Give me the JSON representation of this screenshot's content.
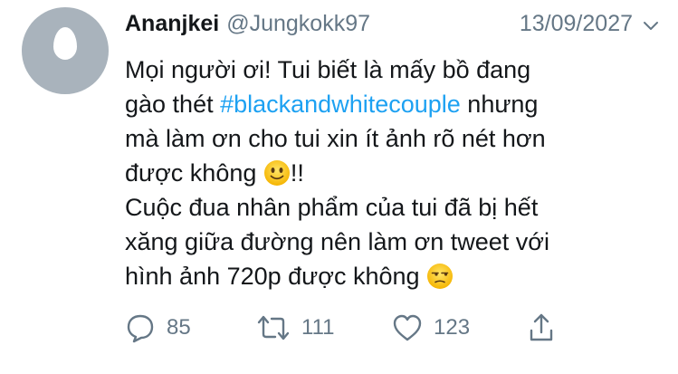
{
  "tweet": {
    "author_name": "Ananjkei",
    "handle": "@Jungkokk97",
    "date": "13/09/2027",
    "text": {
      "line1": "Mọi người ơi! Tui biết là mấy bồ đang",
      "line2_pre": "gào thét ",
      "hashtag": "#blackandwhitecouple",
      "line2_post": " nhưng",
      "line3": "mà làm ơn cho tui xin ít ảnh rõ nét hơn",
      "line4_pre": "được không ",
      "line4_post": "!!",
      "line5": "Cuộc đua nhân phẩm của tui đã bị hết",
      "line6": "xăng giữa đường nên làm ơn tweet với",
      "line7_pre": "hình ảnh 720p được không "
    },
    "emojis": [
      "slightly-smiling-face",
      "unamused-face"
    ]
  },
  "actions": {
    "reply_count": "85",
    "retweet_count": "111",
    "like_count": "123"
  },
  "colors": {
    "accent": "#1da1f2",
    "secondary_text": "#657786",
    "avatar_bg": "#a9b3bc"
  }
}
